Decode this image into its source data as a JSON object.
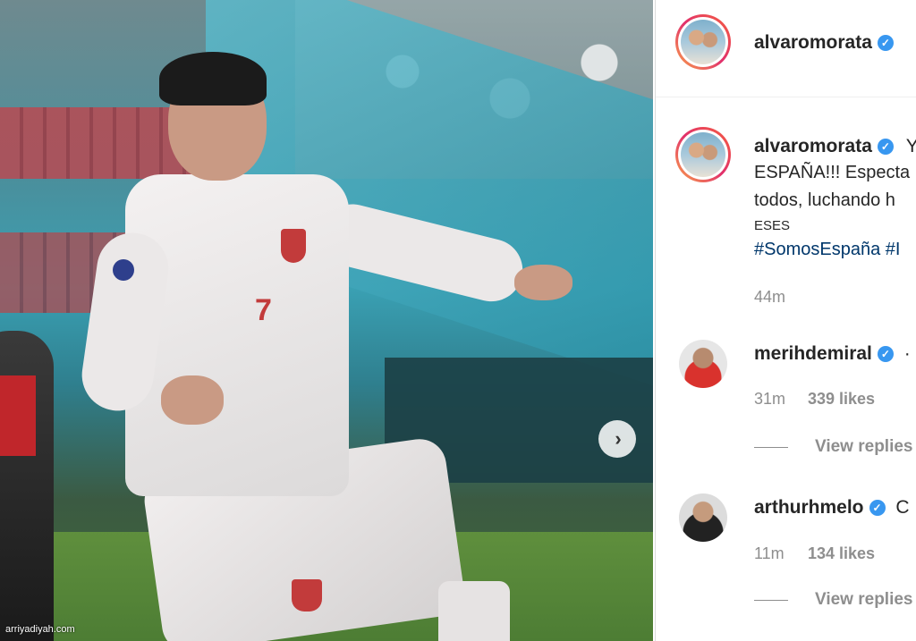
{
  "post": {
    "author": "alvaromorata",
    "caption_lines": [
      "Y",
      "ESPAÑA!!! Especta",
      "todos, luchando h"
    ],
    "caption_prefix": "Y",
    "translation_tag": "ESES",
    "hashtags": "#SomosEspaña #I",
    "time_ago": "44m",
    "next_icon": "chevron-right-icon",
    "watermark": "arriyadiyah.com"
  },
  "comments": [
    {
      "username": "merihdemiral",
      "trailing": "·",
      "time_ago": "31m",
      "likes": "339 likes",
      "view_replies": "View replies"
    },
    {
      "username": "arthurhmelo",
      "trailing": "C",
      "time_ago": "11m",
      "likes": "134 likes",
      "view_replies": "View replies"
    }
  ],
  "colors": {
    "verified": "#3897f0",
    "hashtag": "#00376b",
    "muted": "#8e8e8e"
  }
}
